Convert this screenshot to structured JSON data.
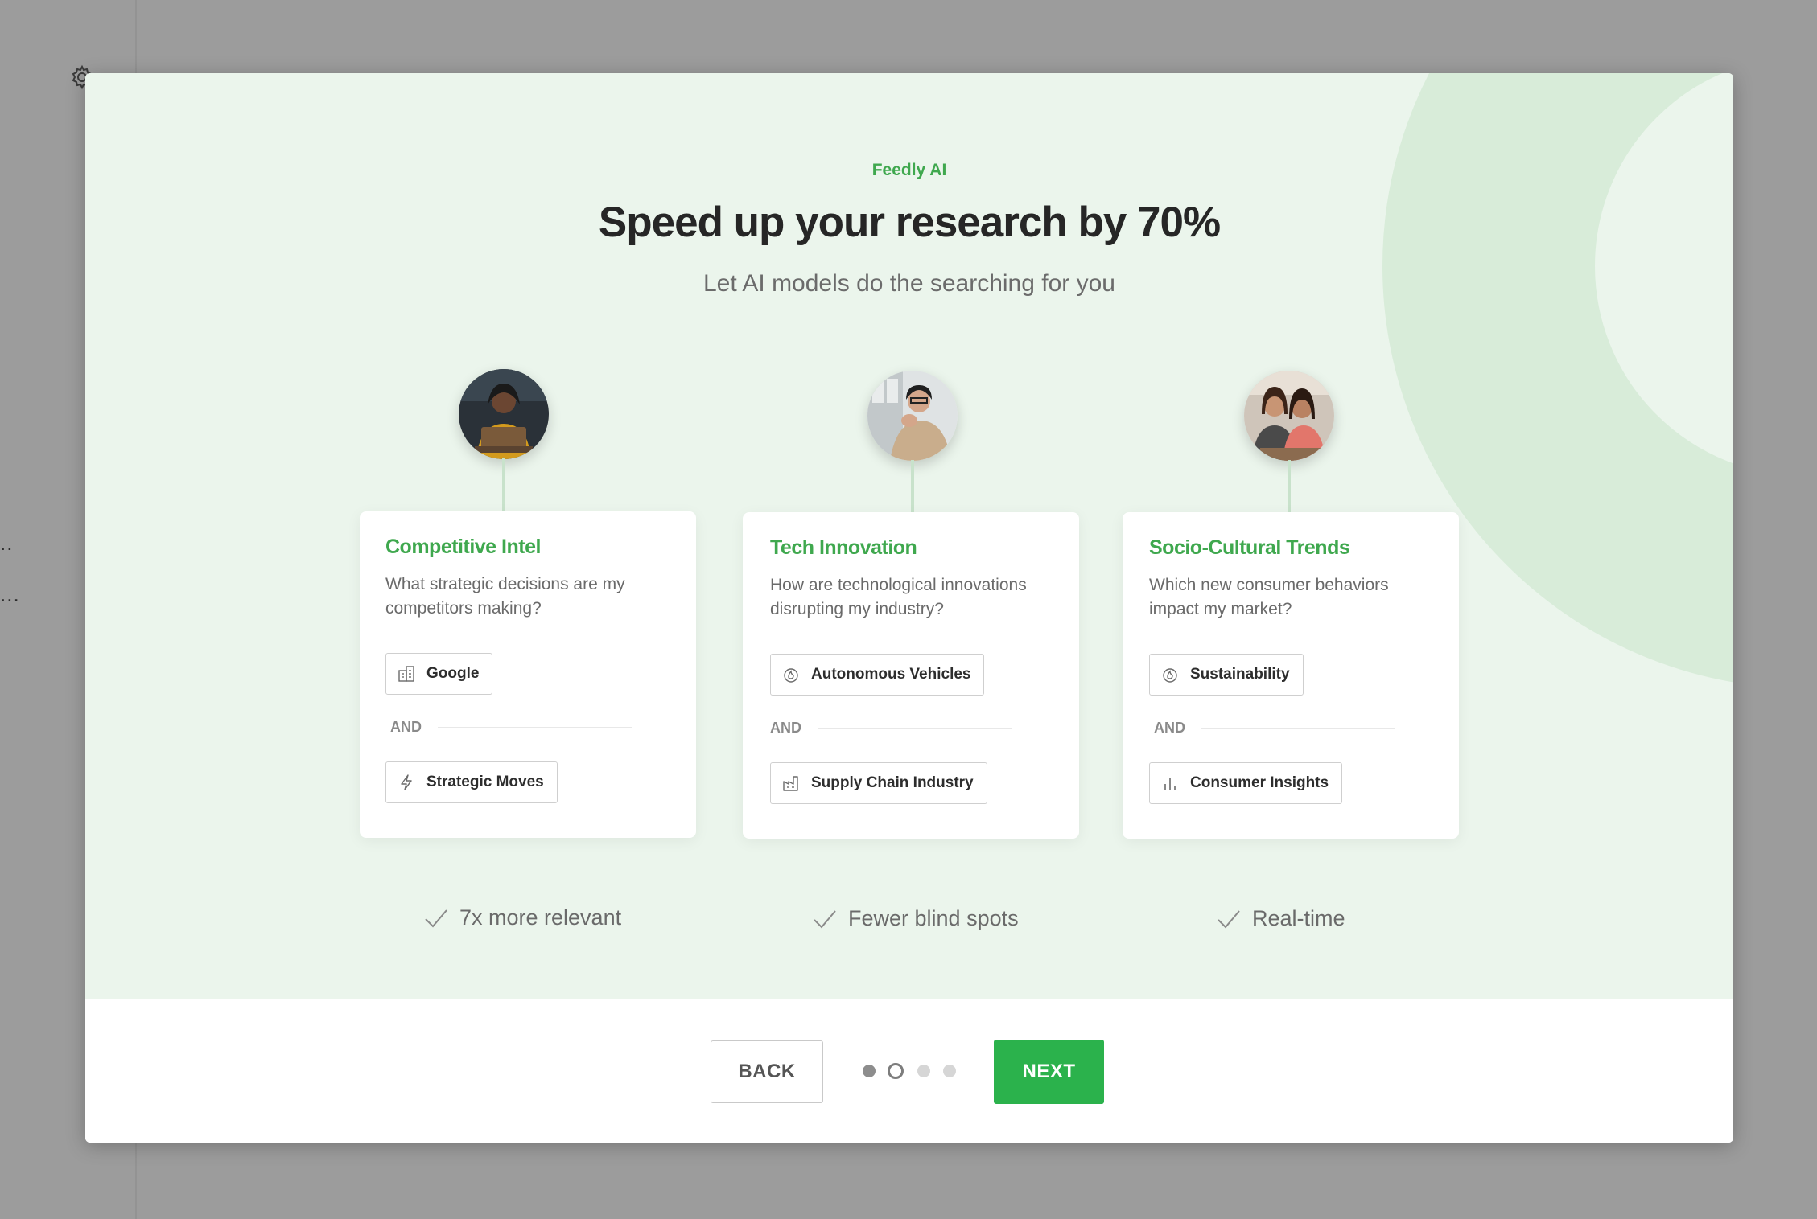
{
  "modal": {
    "eyebrow": "Feedly AI",
    "headline": "Speed up your research by 70%",
    "subheadline": "Let AI models do the searching for you",
    "cards": [
      {
        "title": "Competitive Intel",
        "question": "What strategic decisions are my competitors making?",
        "chip1": {
          "label": "Google",
          "icon": "building-icon"
        },
        "connector": "AND",
        "chip2": {
          "label": "Strategic Moves",
          "icon": "lightning-icon"
        },
        "avatar": "avatar-woman-laptop"
      },
      {
        "title": "Tech Innovation",
        "question": "How are technological innovations disrupting my industry?",
        "chip1": {
          "label": "Autonomous Vehicles",
          "icon": "flame-icon"
        },
        "connector": "AND",
        "chip2": {
          "label": "Supply Chain Industry",
          "icon": "factory-icon"
        },
        "avatar": "avatar-man-thinking"
      },
      {
        "title": "Socio-Cultural Trends",
        "question": "Which new consumer behaviors impact my market?",
        "chip1": {
          "label": "Sustainability",
          "icon": "flame-icon"
        },
        "connector": "AND",
        "chip2": {
          "label": "Consumer Insights",
          "icon": "bar-chart-icon"
        },
        "avatar": "avatar-two-women"
      }
    ],
    "benefits": [
      "7x more relevant",
      "Fewer blind spots",
      "Real-time"
    ],
    "footer": {
      "back_label": "BACK",
      "next_label": "NEXT",
      "steps_total": 4,
      "current_step": 2
    }
  },
  "background": {
    "dots_row1": "..",
    "dots_row2": "..."
  },
  "colors": {
    "accent": "#3fa84e",
    "next_button": "#2bb24c",
    "hero_bg": "#ebf5ec",
    "arc": "#d8ecd9"
  }
}
